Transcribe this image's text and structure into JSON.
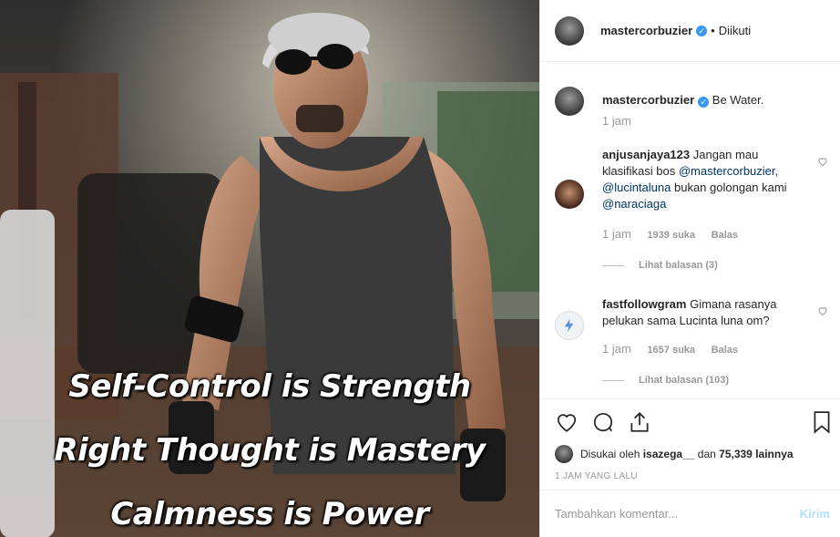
{
  "header": {
    "username": "mastercorbuzier",
    "verified_icon": "verified-badge-icon",
    "separator": "•",
    "follow_status": "Diikuti"
  },
  "photo": {
    "lines": [
      "Self-Control is Strength",
      "Right Thought is Mastery",
      "Calmness is Power"
    ]
  },
  "caption": {
    "username": "mastercorbuzier",
    "text": "Be Water.",
    "time": "1 jam"
  },
  "comments": [
    {
      "username": "anjusanjaya123",
      "text_before": "Jangan mau klasifikasi bos",
      "mention1": "@mastercorbuzier,",
      "mention2": "@lucintaluna",
      "text_mid": "bukan golongan kami",
      "mention3": "@naraciaga",
      "time": "1 jam",
      "likes": "1939 suka",
      "reply": "Balas",
      "view_replies": "Lihat balasan (3)"
    },
    {
      "username": "fastfollowgram",
      "text": "Gimana rasanya pelukan sama Lucinta luna om?",
      "time": "1 jam",
      "likes": "1657 suka",
      "reply": "Balas",
      "view_replies": "Lihat balasan (103)"
    }
  ],
  "likes": {
    "prefix": "Disukai oleh",
    "user": "isazega__",
    "mid": "dan",
    "count": "75,339 lainnya"
  },
  "post_time": "1 JAM YANG LALU",
  "comment_box": {
    "placeholder": "Tambahkan komentar...",
    "submit": "Kirim"
  },
  "colors": {
    "accent": "#3897f0",
    "mention": "#003569",
    "muted": "#999999",
    "submit_disabled": "#b2dffc"
  }
}
